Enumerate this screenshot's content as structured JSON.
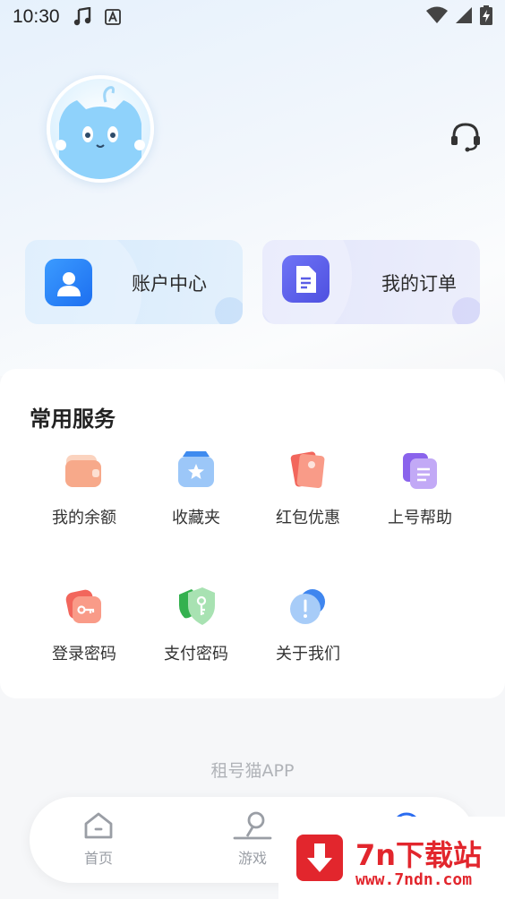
{
  "status_bar": {
    "time": "10:30",
    "icons": [
      "music-note-icon",
      "font-a-icon",
      "wifi-icon",
      "signal-icon",
      "battery-charging-icon"
    ]
  },
  "header": {
    "avatar_icon": "cat-avatar-icon",
    "support_icon": "headset-icon"
  },
  "cards": {
    "account": {
      "label": "账户中心",
      "icon": "user-icon",
      "color": "#1d6ff0"
    },
    "orders": {
      "label": "我的订单",
      "icon": "document-icon",
      "color": "#4e50e0"
    }
  },
  "services": {
    "title": "常用服务",
    "items": [
      {
        "label": "我的余额",
        "icon": "wallet-icon",
        "color": "#f7a98a"
      },
      {
        "label": "收藏夹",
        "icon": "star-box-icon",
        "color": "#6aa7f3"
      },
      {
        "label": "红包优惠",
        "icon": "red-packet-icon",
        "color": "#f2665c"
      },
      {
        "label": "上号帮助",
        "icon": "help-doc-icon",
        "color": "#a57cf1"
      },
      {
        "label": "登录密码",
        "icon": "key-icon",
        "color": "#f2756b"
      },
      {
        "label": "支付密码",
        "icon": "shield-key-icon",
        "color": "#5fcf76"
      },
      {
        "label": "关于我们",
        "icon": "info-icon",
        "color": "#4f8ff2"
      }
    ]
  },
  "footer_text": "租号猫APP",
  "tabbar": {
    "tabs": [
      {
        "label": "首页",
        "icon": "home-icon"
      },
      {
        "label": "游戏",
        "icon": "game-icon"
      },
      {
        "label": "",
        "icon": "profile-icon"
      }
    ]
  },
  "watermark": {
    "title": "7n下载站",
    "url": "www.7ndn.com"
  }
}
